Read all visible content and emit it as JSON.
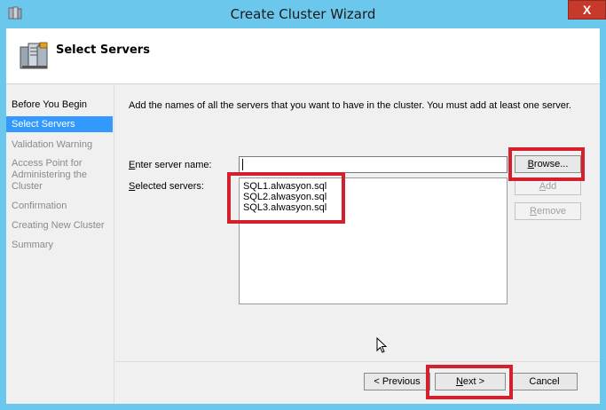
{
  "window": {
    "title": "Create Cluster Wizard",
    "close_glyph": "X"
  },
  "header": {
    "title": "Select Servers",
    "icon": "servers-icon"
  },
  "sidebar": {
    "items": [
      {
        "label": "Before You Begin",
        "state": "done"
      },
      {
        "label": "Select Servers",
        "state": "active"
      },
      {
        "label": "Validation Warning",
        "state": "pending"
      },
      {
        "label": "Access Point for Administering the Cluster",
        "state": "pending"
      },
      {
        "label": "Confirmation",
        "state": "pending"
      },
      {
        "label": "Creating New Cluster",
        "state": "pending"
      },
      {
        "label": "Summary",
        "state": "pending"
      }
    ]
  },
  "main": {
    "description": "Add the names of all the servers that you want to have in the cluster. You must add at least one server.",
    "server_name_label_ul": "E",
    "server_name_label_rest": "nter server name:",
    "server_name_value": "",
    "selected_label_ul": "S",
    "selected_label_rest": "elected servers:",
    "selected_servers": [
      "SQL1.alwasyon.sql",
      "SQL2.alwasyon.sql",
      "SQL3.alwasyon.sql"
    ],
    "browse_ul": "B",
    "browse_rest": "rowse...",
    "add_ul": "A",
    "add_rest": "dd",
    "remove_ul": "R",
    "remove_rest": "emove"
  },
  "footer": {
    "previous_ul": "< P",
    "previous_rest": "revious",
    "next_ul": "N",
    "next_rest": "ext >",
    "cancel_label": "Cancel"
  },
  "colors": {
    "title_bar": "#6cc7ec",
    "highlight": "#d41f2c",
    "active_nav": "#3399ff"
  }
}
